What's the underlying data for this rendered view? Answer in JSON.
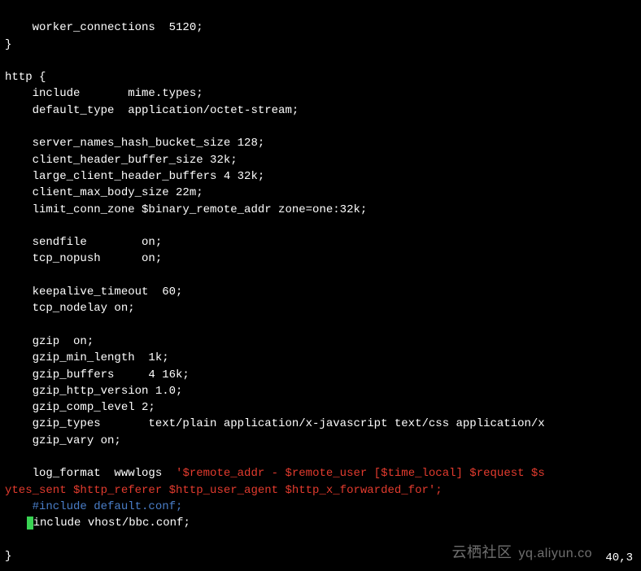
{
  "config": {
    "l01": "    worker_connections  5120;",
    "l02": "}",
    "l03": "",
    "l04": "http {",
    "l05": "    include       mime.types;",
    "l06": "    default_type  application/octet-stream;",
    "l07": "",
    "l08": "    server_names_hash_bucket_size 128;",
    "l09": "    client_header_buffer_size 32k;",
    "l10": "    large_client_header_buffers 4 32k;",
    "l11": "    client_max_body_size 22m;",
    "l12": "    limit_conn_zone $binary_remote_addr zone=one:32k;",
    "l13": "",
    "l14": "    sendfile        on;",
    "l15": "    tcp_nopush      on;",
    "l16": "",
    "l17": "    keepalive_timeout  60;",
    "l18": "    tcp_nodelay on;",
    "l19": "",
    "l20": "    gzip  on;",
    "l21": "    gzip_min_length  1k;",
    "l22": "    gzip_buffers     4 16k;",
    "l23": "    gzip_http_version 1.0;",
    "l24": "    gzip_comp_level 2;",
    "l25": "    gzip_types       text/plain application/x-javascript text/css application/x",
    "l26": "    gzip_vary on;",
    "l27": "",
    "l28_a": "    log_format  wwwlogs  ",
    "l28_b": "'$remote_addr - $remote_user [$time_local] $request $s",
    "l29": "ytes_sent $http_referer $http_user_agent $http_x_forwarded_for';",
    "l30": "    #include default.conf;",
    "l31_a": "    ",
    "l31_b": "include vhost/bbc.conf;",
    "l32": "",
    "l33": "}"
  },
  "status": {
    "position": "40,3"
  },
  "watermark": {
    "cn": "云栖社区",
    "url": "yq.aliyun.co"
  }
}
